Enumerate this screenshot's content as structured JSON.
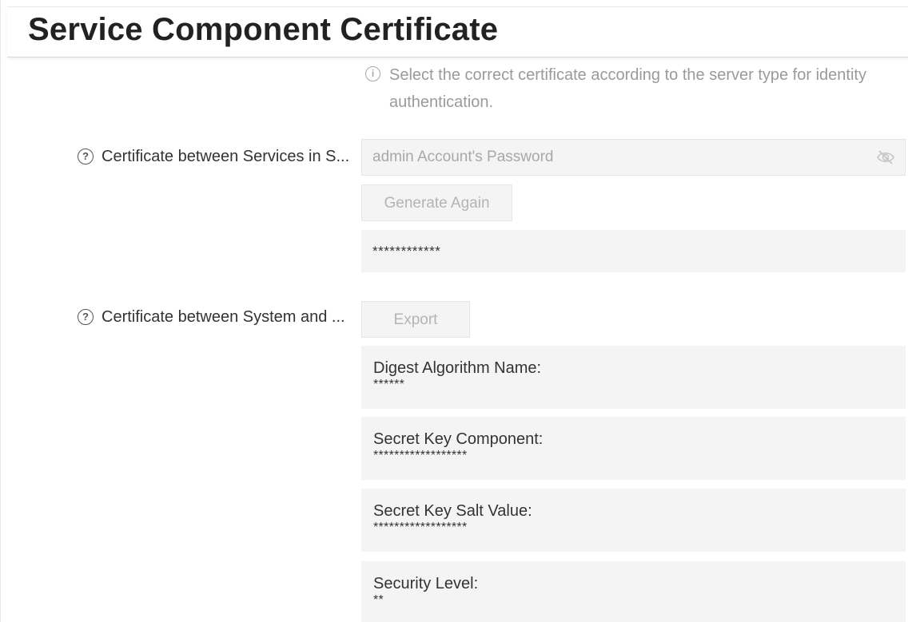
{
  "header": {
    "title": "Service Component Certificate"
  },
  "hint": {
    "icon": "info-icon",
    "text": "Select the correct certificate according to the server type for identity authentication."
  },
  "services_cert": {
    "label": "Certificate between Services in S...",
    "help_icon": "help-icon",
    "password_placeholder": "admin Account's Password",
    "password_value": "",
    "eye_icon": "eye-hidden-icon",
    "generate_label": "Generate Again",
    "masked_value": "************"
  },
  "system_cert": {
    "label": "Certificate between System and ...",
    "help_icon": "help-icon",
    "export_label": "Export",
    "fields": [
      {
        "label": "Digest Algorithm Name:",
        "value": "******"
      },
      {
        "label": "Secret Key Component:",
        "value": "******************"
      },
      {
        "label": "Secret Key Salt Value:",
        "value": "******************"
      },
      {
        "label": "Security Level:",
        "value": "**"
      }
    ]
  },
  "colors": {
    "field_background": "#f4f4f4",
    "disabled_text": "#b4b4b4",
    "hint_text": "#9a9a9a",
    "primary_text": "#333333"
  }
}
